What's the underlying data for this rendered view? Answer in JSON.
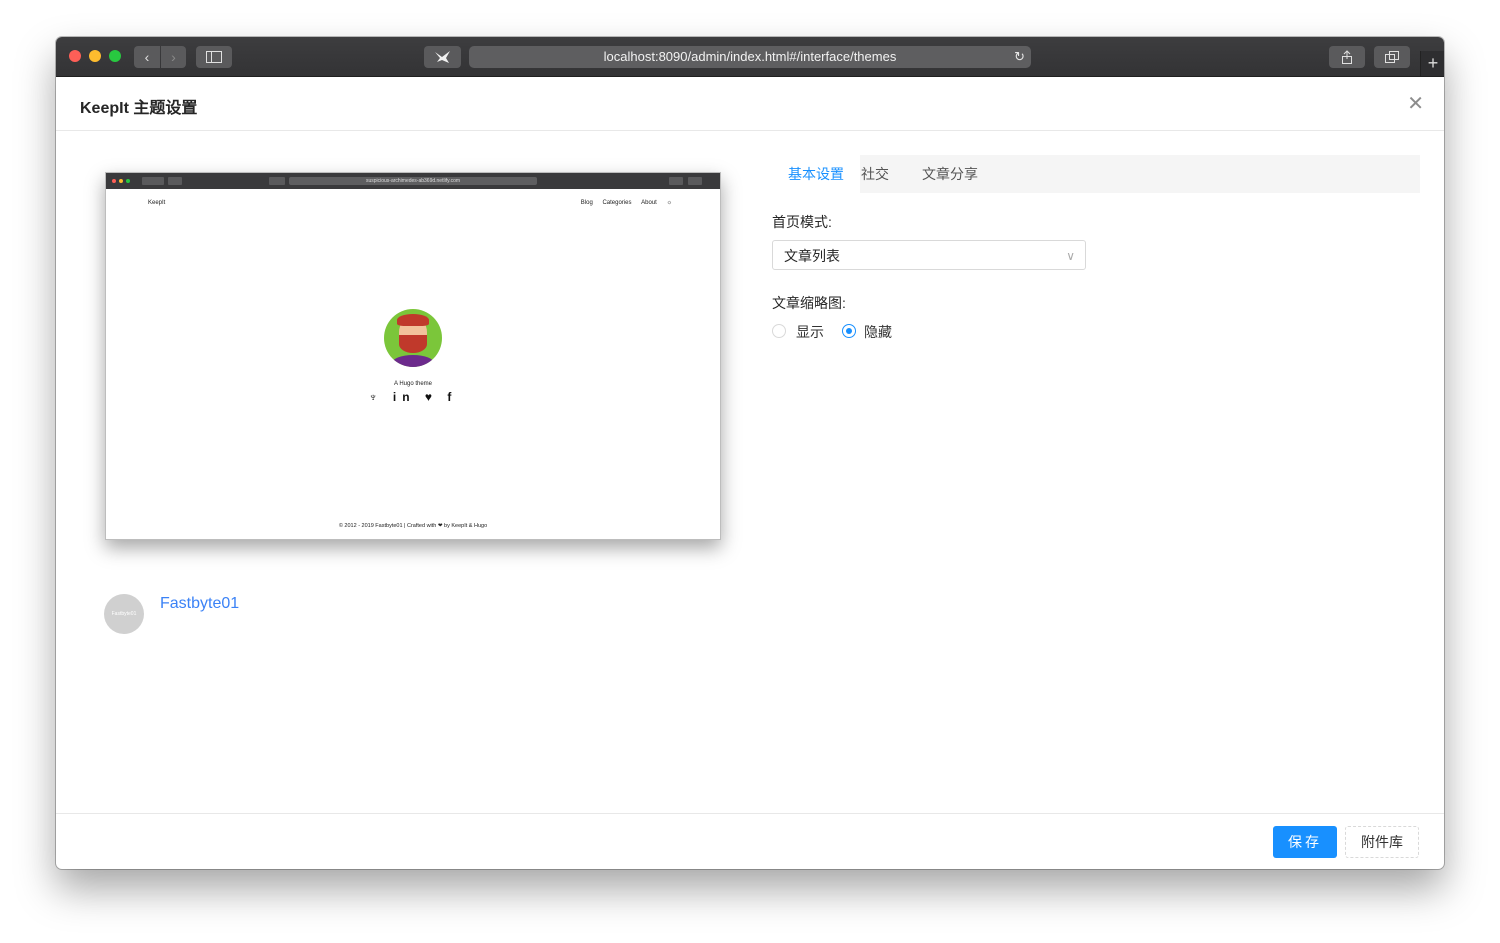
{
  "browser": {
    "url": "localhost:8090/admin/index.html#/interface/themes",
    "new_tab_label": "+"
  },
  "modal": {
    "title": "KeepIt 主题设置",
    "close_icon": "close-icon"
  },
  "preview": {
    "url": "suspicious-archimedes-ab369d.netlify.com",
    "brand": "KeepIt",
    "nav": [
      "Blog",
      "Categories",
      "About",
      "☼"
    ],
    "tagline": "A Hugo theme",
    "social_icons": [
      "github-icon",
      "linkedin-icon",
      "twitter-icon",
      "facebook-icon"
    ],
    "social_glyphs": "♆ in ♥ f",
    "footer": "© 2012 - 2019 Fastbyte01 | Crafted with ❤ by KeepIt & Hugo"
  },
  "author": {
    "avatar_text": "Fastbyte01",
    "name": "Fastbyte01"
  },
  "tabs": [
    {
      "label": "基本设置",
      "active": true
    },
    {
      "label": "社交",
      "active": false
    },
    {
      "label": "文章分享",
      "active": false
    }
  ],
  "form": {
    "home_mode_label": "首页模式:",
    "home_mode_value": "文章列表",
    "thumbnail_label": "文章缩略图:",
    "thumbnail_options": [
      {
        "label": "显示",
        "checked": false
      },
      {
        "label": "隐藏",
        "checked": true
      }
    ]
  },
  "footer": {
    "save_label": "保存",
    "attachments_label": "附件库"
  },
  "colors": {
    "accent": "#1890ff",
    "author_link": "#3b82f6"
  }
}
